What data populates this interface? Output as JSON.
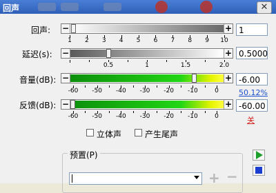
{
  "window": {
    "title": "回声",
    "close_glyph": "✕"
  },
  "echo": {
    "label": "回声:",
    "value": "1",
    "ticks": [
      "1",
      "2",
      "3",
      "4",
      "5",
      "6",
      "7",
      "8",
      "9",
      "10"
    ],
    "level": 1
  },
  "delay": {
    "label": "延迟(s):",
    "value": "0.5000",
    "ticks": [
      "0.5",
      "1",
      "1.5",
      "2.0"
    ],
    "level": 0.5
  },
  "volume": {
    "label": "音量(dB):",
    "value": "-6.00",
    "ticks": [
      "-60",
      "-50",
      "-40",
      "-30",
      "-20",
      "-10",
      "0"
    ],
    "level": -6,
    "percent_link": "50.12%"
  },
  "feedback": {
    "label": "反馈(dB):",
    "value": "-60.00",
    "ticks": [
      "-60",
      "-50",
      "-40",
      "-30",
      "-20",
      "-10",
      "0"
    ],
    "level": -60,
    "off_link": "关"
  },
  "options": {
    "stereo_label": "立体声",
    "tail_label": "产生尾声"
  },
  "preset": {
    "group_label": "预置(P)",
    "selected": "",
    "add_glyph": "+",
    "remove_glyph": "−"
  },
  "sidebar": {
    "play_icon": "play-icon",
    "stop_icon": "stop-icon"
  },
  "colors": {
    "play_green": "#1e9e2a",
    "stop_blue": "#1a3fd0",
    "link_blue": "#1a4fd0",
    "off_red": "#d92020"
  }
}
